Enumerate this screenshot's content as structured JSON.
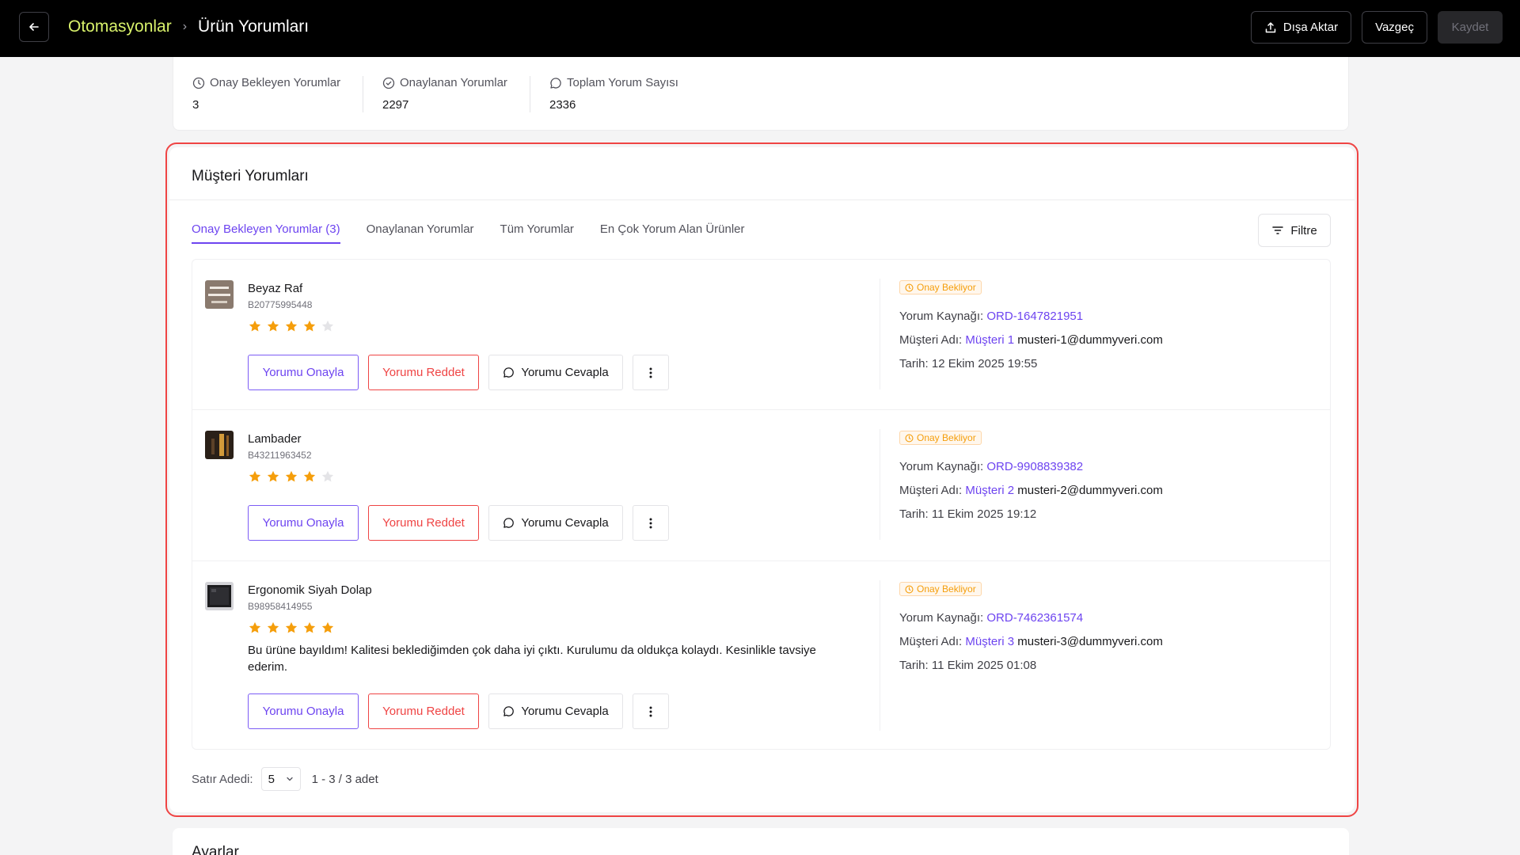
{
  "header": {
    "breadcrumb_parent": "Otomasyonlar",
    "breadcrumb_current": "Ürün Yorumları",
    "export_label": "Dışa Aktar",
    "cancel_label": "Vazgeç",
    "save_label": "Kaydet"
  },
  "stats": [
    {
      "label": "Onay Bekleyen Yorumlar",
      "value": "3",
      "icon": "clock-icon"
    },
    {
      "label": "Onaylanan Yorumlar",
      "value": "2297",
      "icon": "check-circle-icon"
    },
    {
      "label": "Toplam Yorum Sayısı",
      "value": "2336",
      "icon": "chat-icon"
    }
  ],
  "reviews_card": {
    "title": "Müşteri Yorumları",
    "tabs": [
      {
        "label": "Onay Bekleyen Yorumlar (3)",
        "active": true
      },
      {
        "label": "Onaylanan Yorumlar",
        "active": false
      },
      {
        "label": "Tüm Yorumlar",
        "active": false
      },
      {
        "label": "En Çok Yorum Alan Ürünler",
        "active": false
      }
    ],
    "filter_label": "Filtre",
    "labels": {
      "approve": "Yorumu Onayla",
      "reject": "Yorumu Reddet",
      "reply": "Yorumu Cevapla",
      "status": "Onay Bekliyor",
      "source": "Yorum Kaynağı:",
      "customer": "Müşteri Adı:",
      "date": "Tarih:"
    },
    "reviews": [
      {
        "product": "Beyaz Raf",
        "sku": "B20775995448",
        "rating": 4,
        "comment": "",
        "order": "ORD-1647821951",
        "customer_name": "Müşteri 1",
        "customer_email": "musteri-1@dummyveri.com",
        "date": "12 Ekim 2025 19:55"
      },
      {
        "product": "Lambader",
        "sku": "B43211963452",
        "rating": 4,
        "comment": "",
        "order": "ORD-9908839382",
        "customer_name": "Müşteri 2",
        "customer_email": "musteri-2@dummyveri.com",
        "date": "11 Ekim 2025 19:12"
      },
      {
        "product": "Ergonomik Siyah Dolap",
        "sku": "B98958414955",
        "rating": 5,
        "comment": "Bu ürüne bayıldım! Kalitesi beklediğimden çok daha iyi çıktı. Kurulumu da oldukça kolaydı. Kesinlikle tavsiye ederim.",
        "order": "ORD-7462361574",
        "customer_name": "Müşteri 3",
        "customer_email": "musteri-3@dummyveri.com",
        "date": "11 Ekim 2025 01:08"
      }
    ],
    "pagination": {
      "rows_label": "Satır Adedi:",
      "rows_value": "5",
      "range_text": "1 - 3 / 3 adet"
    }
  },
  "settings": {
    "title": "Ayarlar"
  },
  "colors": {
    "accent": "#6d44f0",
    "star": "#f59e0b",
    "reject": "#ef4444",
    "highlight": "#d9f26b"
  }
}
